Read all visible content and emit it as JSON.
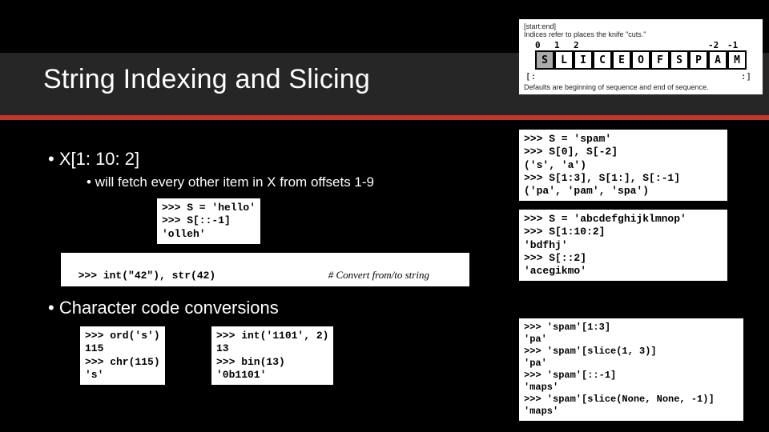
{
  "title": "String Indexing and Slicing",
  "bullets": {
    "b1": "X[1: 10: 2]",
    "b1sub": "will fetch every other item in X from offsets 1-9",
    "b2": "Character code conversions"
  },
  "diagram": {
    "top_note": "[start:end]\nIndices refer to places the knife \"cuts.\"",
    "pos_indices": [
      "0",
      "1",
      "2",
      "",
      "",
      "",
      "",
      "",
      "",
      "-2",
      "-1"
    ],
    "cells": [
      "S",
      "L",
      "I",
      "C",
      "E",
      "O",
      "F",
      "S",
      "P",
      "A",
      "M"
    ],
    "left_bracket": "[:",
    "right_bracket": ":]",
    "bottom_note": "Defaults are beginning of sequence and end of sequence."
  },
  "code": {
    "hello": ">>> S = 'hello'\n>>> S[::-1]\n'olleh'",
    "convert": ">>> int(\"42\"), str(42)",
    "convert_comment": "# Convert from/to string",
    "ord": ">>> ord('s')\n115\n>>> chr(115)\n's'",
    "bin": ">>> int('1101', 2)\n13\n>>> bin(13)\n'0b1101'",
    "spam": ">>> S = 'spam'\n>>> S[0], S[-2]\n('s', 'a')\n>>> S[1:3], S[1:], S[:-1]\n('pa', 'pam', 'spa')",
    "abcdef": ">>> S = 'abcdefghijklmnop'\n>>> S[1:10:2]\n'bdfhj'\n>>> S[::2]\n'acegikmo'",
    "sliceobj": ">>> 'spam'[1:3]\n'pa'\n>>> 'spam'[slice(1, 3)]\n'pa'\n>>> 'spam'[::-1]\n'maps'\n>>> 'spam'[slice(None, None, -1)]\n'maps'"
  }
}
